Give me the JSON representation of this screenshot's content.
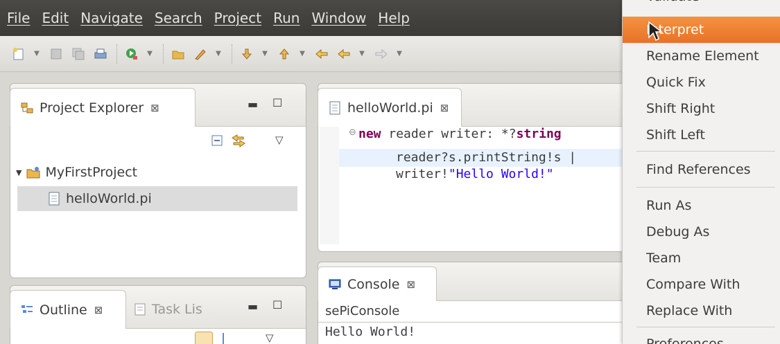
{
  "menu": [
    "File",
    "Edit",
    "Navigate",
    "Search",
    "Project",
    "Run",
    "Window",
    "Help"
  ],
  "project_explorer": {
    "tab_label": "Project Explorer",
    "close_glyph": "⊠",
    "project": "MyFirstProject",
    "file": "helloWorld.pi"
  },
  "outline": {
    "tab_label": "Outline",
    "close_glyph": "⊠",
    "other_tab": "Task Lis"
  },
  "editor": {
    "tab_label": "helloWorld.pi",
    "close_glyph": "⊠",
    "line1_kw": "new",
    "line1_rest": " reader writer: *?",
    "line1_type": "string",
    "line2": "reader?s.printString!s |",
    "line3_pre": "writer!",
    "line3_str": "\"Hello World!\""
  },
  "console": {
    "tab_label": "Console",
    "close_glyph": "⊠",
    "name": "sePiConsole",
    "output": "Hello World!"
  },
  "context_menu": {
    "top_partial": "Validate",
    "items": [
      "Interpret",
      "Rename Element",
      "Quick Fix",
      "Shift Right",
      "Shift Left",
      "Find References",
      "Run As",
      "Debug As",
      "Team",
      "Compare With",
      "Replace With",
      "Preferences"
    ],
    "highlighted": "Interpret"
  },
  "colors": {
    "menubar": "#3b3a36",
    "highlight": "#e8722a",
    "keyword": "#7f0055",
    "string": "#2a00ff"
  }
}
